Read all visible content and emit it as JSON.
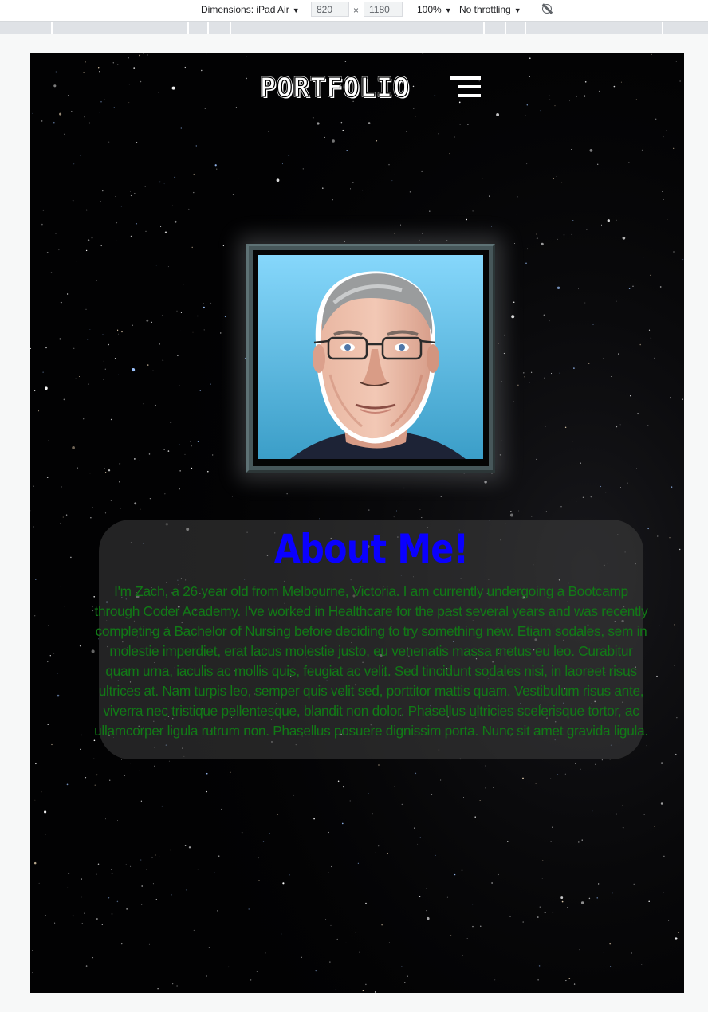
{
  "devtools": {
    "dimensions_label": "Dimensions: iPad Air",
    "width_value": "820",
    "height_value": "1180",
    "times_sign": "×",
    "zoom": "100%",
    "throttling": "No throttling",
    "caret": "▼"
  },
  "header": {
    "logo_text": "PORTFOLIO",
    "menu_icon": "hamburger-menu-icon"
  },
  "profile": {
    "portrait_icon": "cartoon-portrait"
  },
  "about": {
    "title": "About Me!",
    "body": "I'm Zach, a 26 year old from Melbourne, Victoria. I am currently undergoing a Bootcamp through Coder Academy. I've worked in Healthcare for the past several years and was recently completing a Bachelor of Nursing before deciding to try something new. Etiam sodales, sem in molestie imperdiet, erat lacus molestie justo, eu venenatis massa metus eu leo. Curabitur quam urna, iaculis ac mollis quis, feugiat ac velit. Sed tincidunt sodales nisi, in laoreet risus ultrices at. Nam turpis leo, semper quis velit sed, porttitor mattis quam. Vestibulum risus ante, viverra nec tristique pellentesque, blandit non dolor. Phasellus ultricies scelerisque tortor, ac ullamcorper ligula rutrum non. Phasellus posuere dignissim porta. Nunc sit amet gravida ligula."
  },
  "colors": {
    "title_blue": "#0a00ff",
    "body_green": "#117a16",
    "background": "#020203",
    "frame": "#47575a"
  }
}
